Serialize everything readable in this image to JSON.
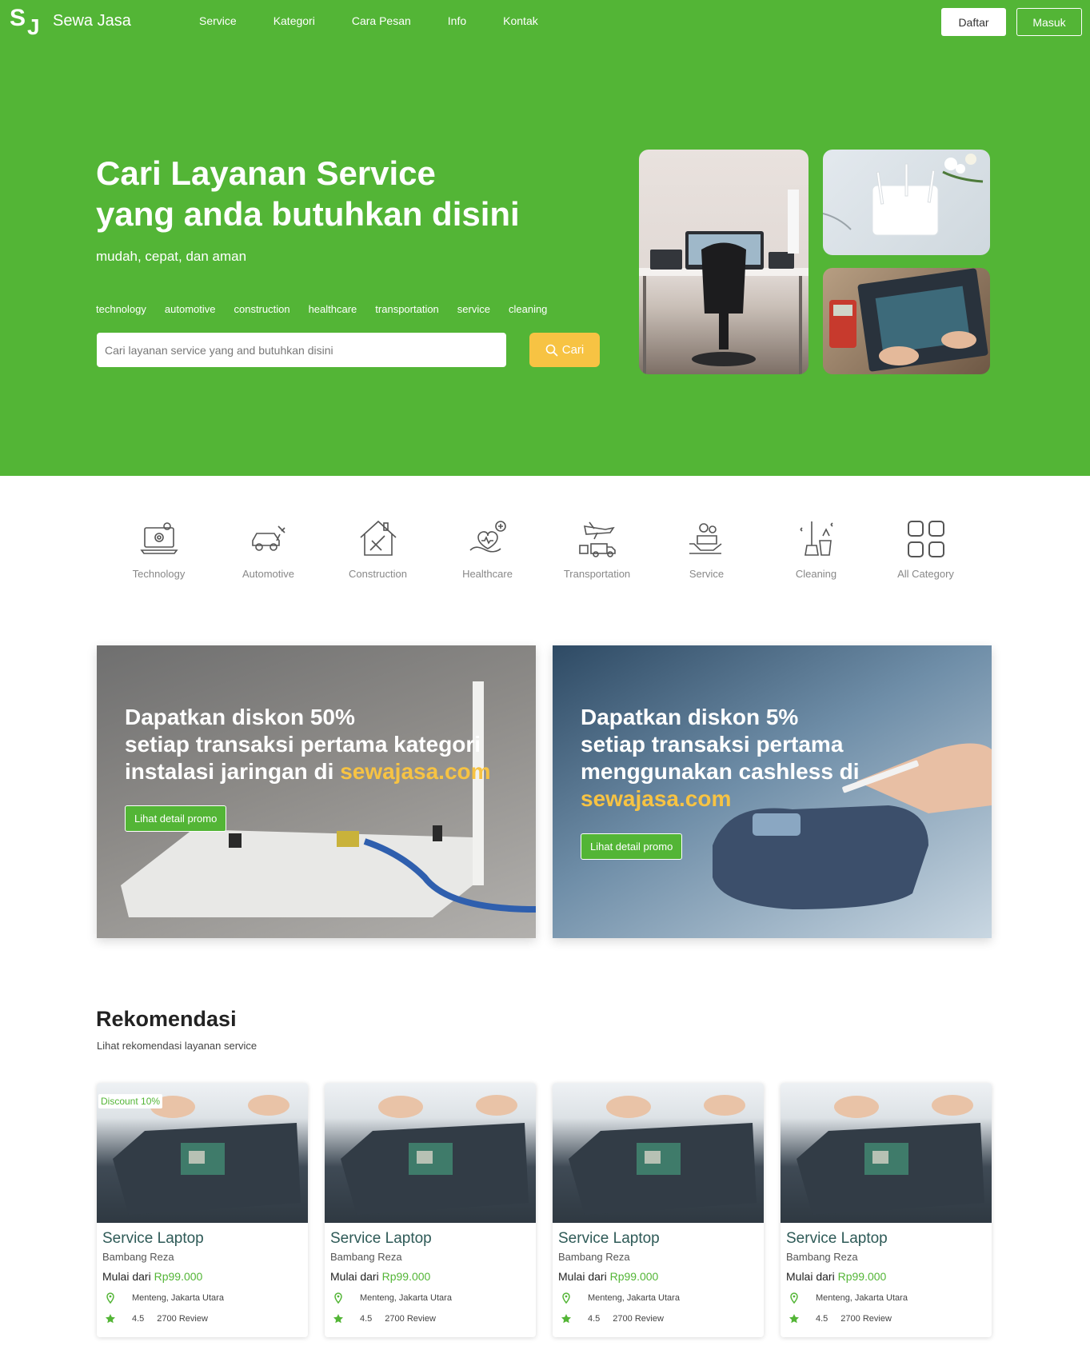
{
  "header": {
    "logo_text": "Sewa Jasa",
    "logo_mark": {
      "s": "S",
      "j": "J"
    },
    "nav": [
      "Service",
      "Kategori",
      "Cara Pesan",
      "Info",
      "Kontak"
    ],
    "daftar_label": "Daftar",
    "masuk_label": "Masuk"
  },
  "hero": {
    "title_line1": "Cari Layanan Service",
    "title_line2": "yang anda butuhkan disini",
    "subtitle": "mudah, cepat, dan aman",
    "tags": [
      "technology",
      "automotive",
      "construction",
      "healthcare",
      "transportation",
      "service",
      "cleaning"
    ],
    "search_placeholder": "Cari layanan service yang and butuhkan disini",
    "search_button": "Cari"
  },
  "categories": [
    {
      "label": "Technology",
      "icon": "laptop-gear-icon"
    },
    {
      "label": "Automotive",
      "icon": "car-wrench-icon"
    },
    {
      "label": "Construction",
      "icon": "house-tools-icon"
    },
    {
      "label": "Healthcare",
      "icon": "hand-heart-icon"
    },
    {
      "label": "Transportation",
      "icon": "plane-truck-icon"
    },
    {
      "label": "Service",
      "icon": "hand-gears-icon"
    },
    {
      "label": "Cleaning",
      "icon": "broom-bucket-icon"
    },
    {
      "label": "All Category",
      "icon": "grid-icon"
    }
  ],
  "promos": [
    {
      "line1": "Dapatkan diskon 50%",
      "line2": "setiap transaksi pertama kategori",
      "line3": "instalasi jaringan di ",
      "highlight": "sewajasa.com",
      "button": "Lihat detail promo"
    },
    {
      "line1": "Dapatkan diskon 5%",
      "line2": "setiap transaksi pertama",
      "line3": "menggunakan cashless di",
      "highlight": "sewajasa.com",
      "button": "Lihat detail promo"
    }
  ],
  "recommendations": {
    "title": "Rekomendasi",
    "subtitle": "Lihat rekomendasi layanan service",
    "cards": [
      {
        "badge": "Discount 10%",
        "title": "Service Laptop",
        "owner": "Bambang Reza",
        "price_prefix": "Mulai dari",
        "price": "Rp99.000",
        "location": "Menteng, Jakarta Utara",
        "rating": "4.5",
        "reviews": "2700 Review"
      },
      {
        "title": "Service Laptop",
        "owner": "Bambang Reza",
        "price_prefix": "Mulai dari",
        "price": "Rp99.000",
        "location": "Menteng, Jakarta Utara",
        "rating": "4.5",
        "reviews": "2700 Review"
      },
      {
        "title": "Service Laptop",
        "owner": "Bambang Reza",
        "price_prefix": "Mulai dari",
        "price": "Rp99.000",
        "location": "Menteng, Jakarta Utara",
        "rating": "4.5",
        "reviews": "2700 Review"
      },
      {
        "title": "Service Laptop",
        "owner": "Bambang Reza",
        "price_prefix": "Mulai dari",
        "price": "Rp99.000",
        "location": "Menteng, Jakarta Utara",
        "rating": "4.5",
        "reviews": "2700 Review"
      }
    ]
  },
  "colors": {
    "brand_green": "#53b536",
    "accent_yellow": "#f7c343",
    "card_title": "#2e5a57"
  }
}
